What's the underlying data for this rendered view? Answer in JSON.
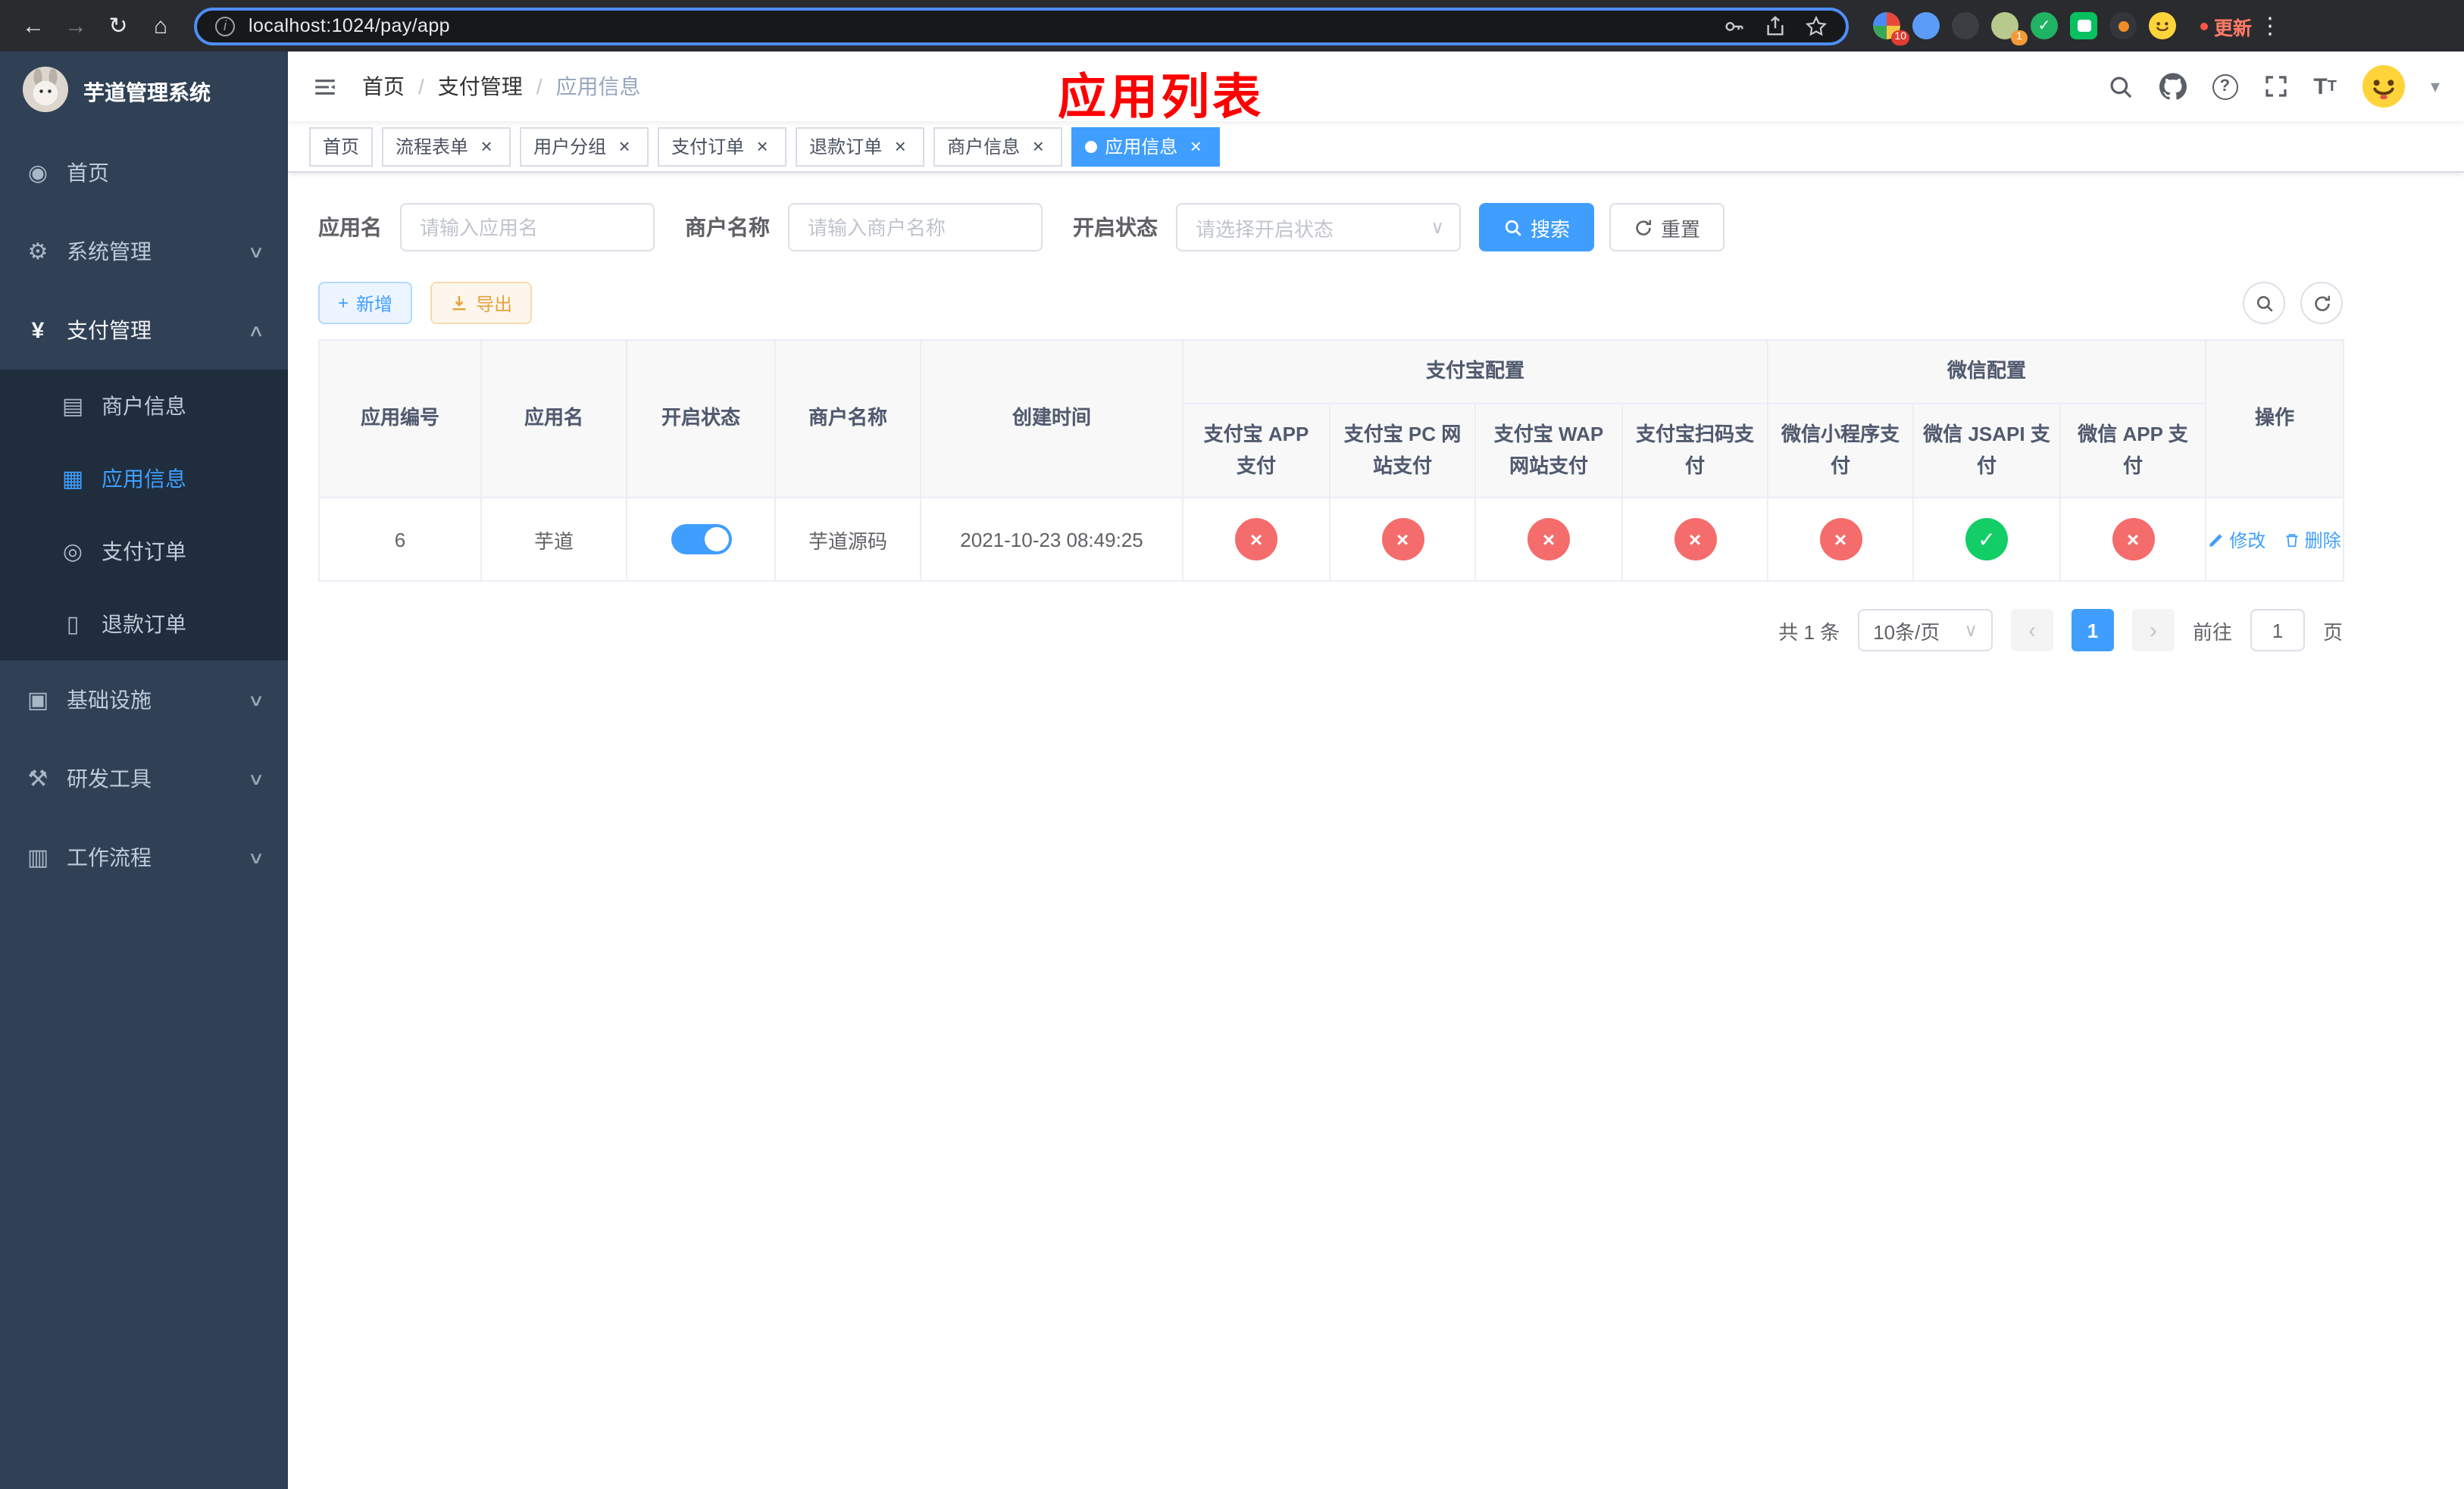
{
  "colors": {
    "primary": "#409eff",
    "success": "#13ce66",
    "danger": "#f56c6c",
    "warning": "#e6a23c",
    "annotation_red": "#fe0000",
    "sidebar_bg": "#304156",
    "submenu_bg": "#1f2d3d"
  },
  "icons": {
    "back": "←",
    "forward": "→",
    "reload": "↻",
    "home": "⌂",
    "info": "i",
    "dots": "⋮",
    "slash": "/",
    "dashboard": "◉",
    "gear": "⚙",
    "yen": "¥",
    "card": "▤",
    "grid": "▦",
    "order": "◎",
    "doc": "▯",
    "infra": "▣",
    "tools": "⚒",
    "flow": "▥",
    "chevron_down": "∨",
    "chevron_up": "∧",
    "caret_down": "▾",
    "close": "×",
    "plus": "+",
    "check": "✓",
    "cross": "×",
    "question": "?",
    "prev": "‹",
    "next": "›"
  },
  "browser": {
    "url": "localhost:1024/pay/app",
    "update_label": "更新",
    "badges": {
      "grid": "10",
      "avatar": "1"
    }
  },
  "sidebar": {
    "app_title": "芋道管理系统",
    "items": [
      {
        "label": "首页"
      },
      {
        "label": "系统管理"
      },
      {
        "label": "支付管理"
      },
      {
        "label": "基础设施"
      },
      {
        "label": "研发工具"
      },
      {
        "label": "工作流程"
      }
    ],
    "submenu": [
      {
        "label": "商户信息"
      },
      {
        "label": "应用信息"
      },
      {
        "label": "支付订单"
      },
      {
        "label": "退款订单"
      }
    ]
  },
  "header": {
    "breadcrumb": [
      "首页",
      "支付管理",
      "应用信息"
    ],
    "annotation": "应用列表"
  },
  "tabs": [
    {
      "label": "首页"
    },
    {
      "label": "流程表单"
    },
    {
      "label": "用户分组"
    },
    {
      "label": "支付订单"
    },
    {
      "label": "退款订单"
    },
    {
      "label": "商户信息"
    },
    {
      "label": "应用信息"
    }
  ],
  "filters": {
    "app_name_label": "应用名",
    "app_name_placeholder": "请输入应用名",
    "merchant_label": "商户名称",
    "merchant_placeholder": "请输入商户名称",
    "status_label": "开启状态",
    "status_placeholder": "请选择开启状态",
    "search_label": "搜索",
    "reset_label": "重置"
  },
  "toolbar": {
    "add_label": "新增",
    "export_label": "导出"
  },
  "table": {
    "col_app_id": "应用编号",
    "col_app_name": "应用名",
    "col_status": "开启状态",
    "col_merchant": "商户名称",
    "col_created": "创建时间",
    "group_alipay": "支付宝配置",
    "group_wechat": "微信配置",
    "col_alipay_app": "支付宝 APP 支付",
    "col_alipay_pc": "支付宝 PC 网站支付",
    "col_alipay_wap": "支付宝 WAP 网站支付",
    "col_alipay_qr": "支付宝扫码支付",
    "col_wechat_mini": "微信小程序支付",
    "col_wechat_jsapi": "微信 JSAPI 支付",
    "col_wechat_app": "微信 APP 支付",
    "col_actions": "操作",
    "row": {
      "id": "6",
      "name": "芋道",
      "status_on": true,
      "merchant": "芋道源码",
      "created": "2021-10-23 08:49:25",
      "configs": [
        false,
        false,
        false,
        false,
        false,
        true,
        false
      ],
      "edit_label": "修改",
      "delete_label": "删除"
    }
  },
  "pagination": {
    "total_text": "共 1 条",
    "page_size_text": "10条/页",
    "current_page": "1",
    "goto_label": "前往",
    "goto_value": "1",
    "page_unit": "页"
  }
}
